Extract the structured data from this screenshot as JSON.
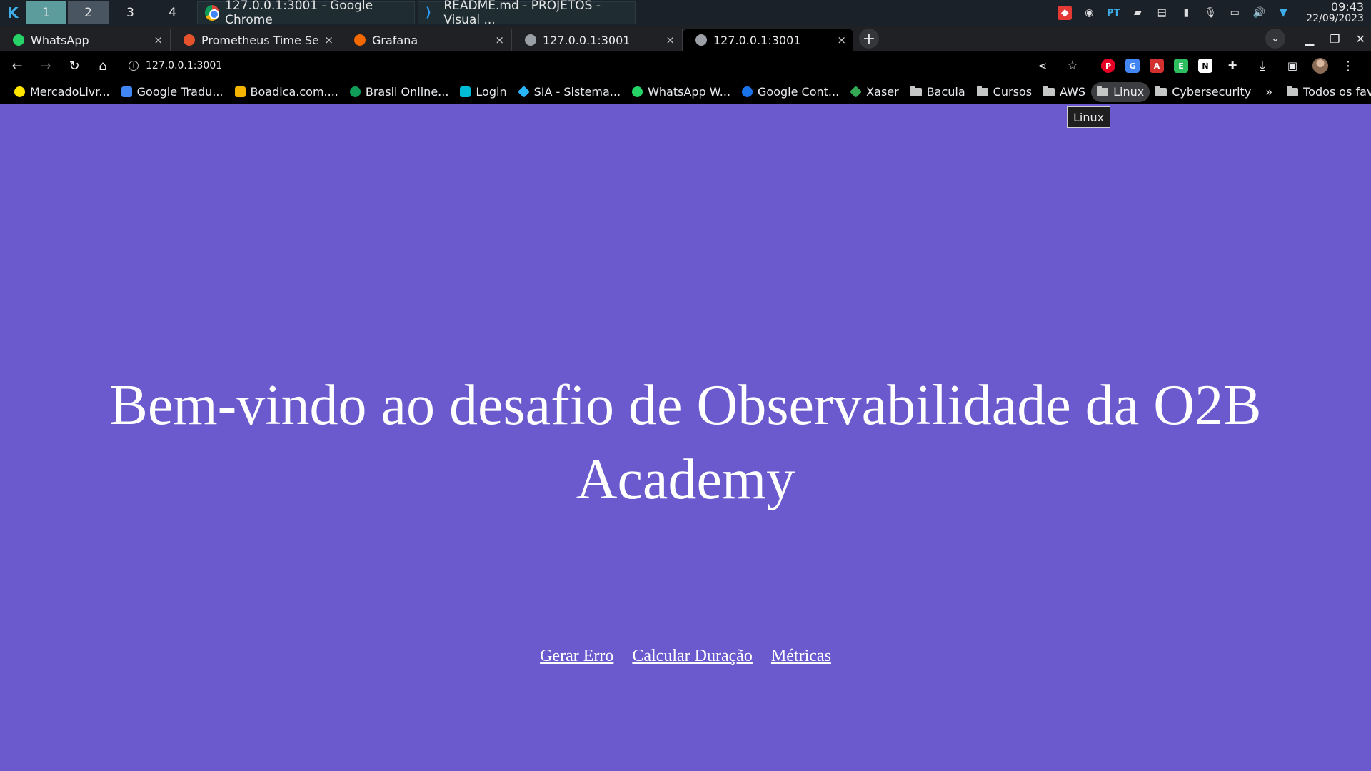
{
  "taskbar": {
    "workspaces": [
      "1",
      "2",
      "3",
      "4"
    ],
    "tasks": [
      {
        "label": "127.0.0.1:3001 - Google Chrome"
      },
      {
        "label": "README.md - PROJETOS - Visual ..."
      }
    ],
    "tray": {
      "lang": "PT",
      "time": "09:43",
      "date": "22/09/2023"
    }
  },
  "tabs": [
    {
      "title": "WhatsApp",
      "close": "×",
      "favicon_color": "#25d366"
    },
    {
      "title": "Prometheus Time Serie",
      "close": "×",
      "favicon_color": "#e6522c"
    },
    {
      "title": "Grafana",
      "close": "×",
      "favicon_color": "#f46800"
    },
    {
      "title": "127.0.0.1:3001",
      "close": "×",
      "favicon_color": "#9aa0a6"
    },
    {
      "title": "127.0.0.1:3001",
      "close": "×",
      "favicon_color": "#9aa0a6"
    }
  ],
  "omnibox": {
    "url": "127.0.0.1:3001"
  },
  "bookmarks": [
    {
      "label": "MercadoLivr...",
      "color": "#ffe600"
    },
    {
      "label": "Google Tradu...",
      "color": "#4285f4"
    },
    {
      "label": "Boadica.com....",
      "color": "#f4b400"
    },
    {
      "label": "Brasil Online...",
      "color": "#0f9d58"
    },
    {
      "label": "Login",
      "color": "#00bcd4"
    },
    {
      "label": "SIA - Sistema...",
      "color": "#29b6f6"
    },
    {
      "label": "WhatsApp W...",
      "color": "#25d366"
    },
    {
      "label": "Google Cont...",
      "color": "#1a73e8"
    },
    {
      "label": "Xaser",
      "color": "#34a853"
    }
  ],
  "bookmark_folders": [
    "Bacula",
    "Cursos",
    "AWS",
    "Linux",
    "Cybersecurity"
  ],
  "other_bookmarks": "Todos os favoritos",
  "tooltip": "Linux",
  "page": {
    "heading": "Bem-vindo ao desafio de Observabilidade da O2B Academy",
    "links": [
      "Gerar Erro",
      "Calcular Duração",
      "Métricas"
    ],
    "background": "#6a5acd"
  }
}
